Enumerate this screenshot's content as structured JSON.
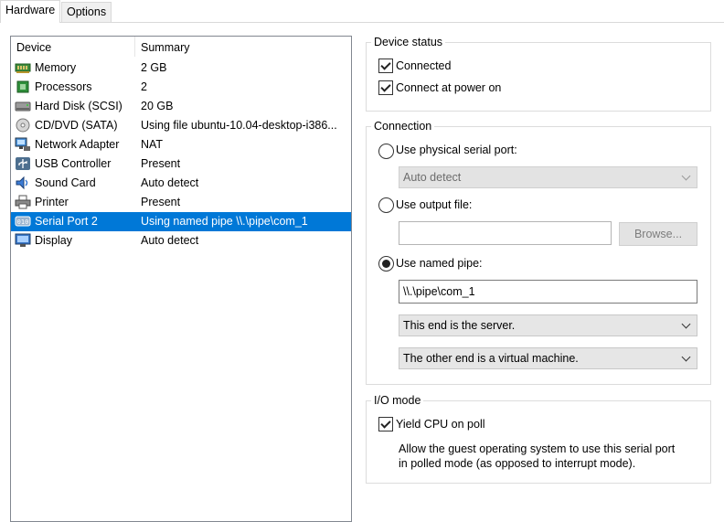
{
  "tabs": [
    {
      "label": "Hardware",
      "active": true
    },
    {
      "label": "Options",
      "active": false
    }
  ],
  "device_list": {
    "columns": [
      "Device",
      "Summary"
    ],
    "rows": [
      {
        "icon": "memory-icon",
        "name": "Memory",
        "summary": "2 GB"
      },
      {
        "icon": "processor-icon",
        "name": "Processors",
        "summary": "2"
      },
      {
        "icon": "hard-disk-icon",
        "name": "Hard Disk (SCSI)",
        "summary": "20 GB"
      },
      {
        "icon": "cd-dvd-icon",
        "name": "CD/DVD (SATA)",
        "summary": "Using file ubuntu-10.04-desktop-i386..."
      },
      {
        "icon": "network-adapter-icon",
        "name": "Network Adapter",
        "summary": "NAT"
      },
      {
        "icon": "usb-icon",
        "name": "USB Controller",
        "summary": "Present"
      },
      {
        "icon": "sound-card-icon",
        "name": "Sound Card",
        "summary": "Auto detect"
      },
      {
        "icon": "printer-icon",
        "name": "Printer",
        "summary": "Present"
      },
      {
        "icon": "serial-port-icon",
        "name": "Serial Port 2",
        "summary": "Using named pipe \\\\.\\pipe\\com_1",
        "selected": true
      },
      {
        "icon": "display-icon",
        "name": "Display",
        "summary": "Auto detect"
      }
    ]
  },
  "device_status": {
    "title": "Device status",
    "connected": {
      "label": "Connected",
      "checked": true
    },
    "connect_at_power_on": {
      "label": "Connect at power on",
      "checked": true
    }
  },
  "connection": {
    "title": "Connection",
    "physical_port": {
      "label": "Use physical serial port:",
      "selected": false,
      "combo_value": "Auto detect"
    },
    "output_file": {
      "label": "Use output file:",
      "selected": false,
      "value": "",
      "browse_label": "Browse..."
    },
    "named_pipe": {
      "label": "Use named pipe:",
      "selected": true,
      "value": "\\\\.\\pipe\\com_1",
      "end_option": "This end is the server.",
      "other_end_option": "The other end is a virtual machine."
    }
  },
  "io_mode": {
    "title": "I/O mode",
    "yield_cpu": {
      "label": "Yield CPU on poll",
      "checked": true
    },
    "description_line1": "Allow the guest operating system to use this serial port",
    "description_line2": "in polled mode (as opposed to interrupt mode)."
  },
  "colors": {
    "selection": "#0078d7",
    "border": "#dcdcdc"
  }
}
